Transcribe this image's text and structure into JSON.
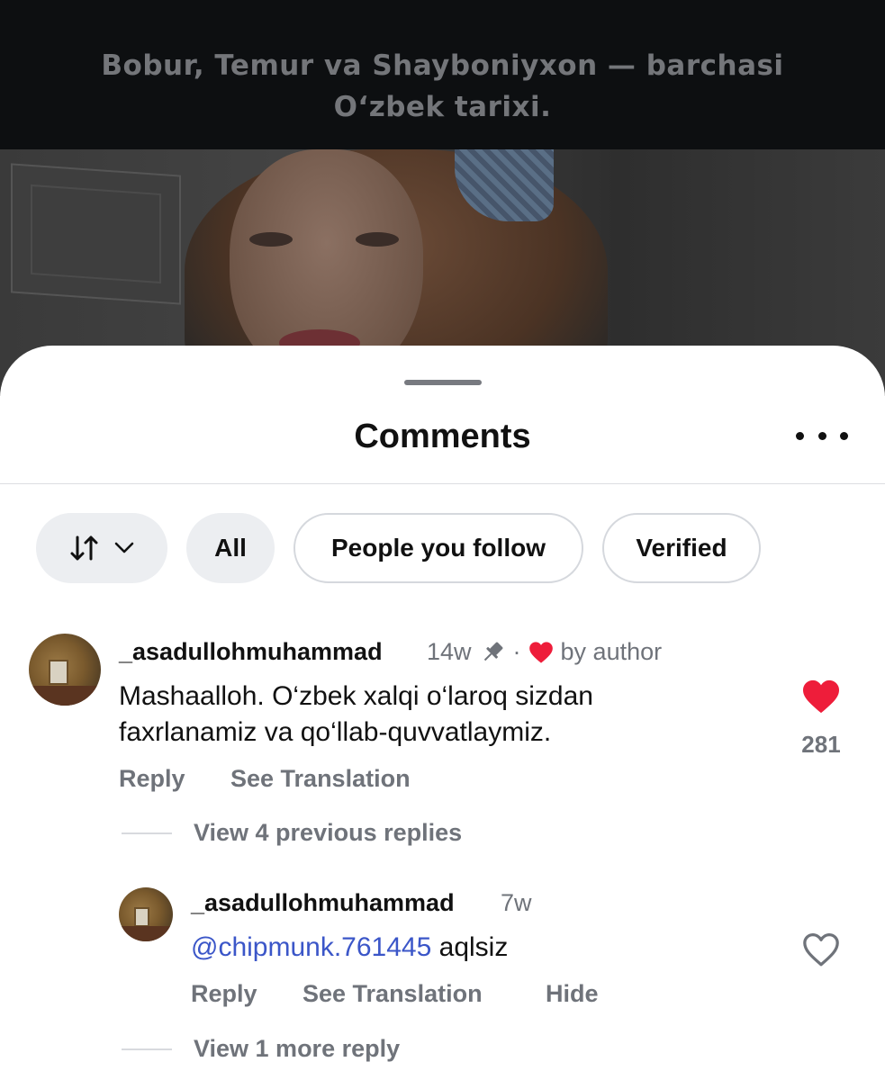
{
  "video": {
    "caption_line1": "Bobur, Temur va Shayboniyxon — barchasi",
    "caption_line2": "O‘zbek tarixi."
  },
  "sheet": {
    "title": "Comments",
    "more_icon": "ellipsis-icon"
  },
  "filters": {
    "sort_icon": "sort-arrows-icon",
    "chips": [
      "All",
      "People you follow",
      "Verified"
    ]
  },
  "comments": [
    {
      "username": "_asadullohmuhammad",
      "age": "14w",
      "pinned": true,
      "liked_by_author_label": "by author",
      "text_line1": "Mashaalloh. O‘zbek xalqi o‘laroq sizdan",
      "text_line2": "faxrlanamiz va qo‘llab-quvvatlaymiz.",
      "likes": "281",
      "liked": true,
      "actions": [
        "Reply",
        "See Translation"
      ],
      "view_replies": "View 4 previous replies",
      "colors": {
        "like": "#ee1d3a"
      }
    }
  ],
  "reply": {
    "username": "_asadullohmuhammad",
    "age": "7w",
    "mention": "@chipmunk.761445",
    "text": "aqlsiz",
    "liked": false,
    "actions": [
      "Reply",
      "See Translation",
      "Hide"
    ],
    "more_replies": "View 1 more reply"
  },
  "colors": {
    "mention": "#3b56c8",
    "secondary_text": "#6f737a",
    "chip_fill": "#eceef1"
  }
}
